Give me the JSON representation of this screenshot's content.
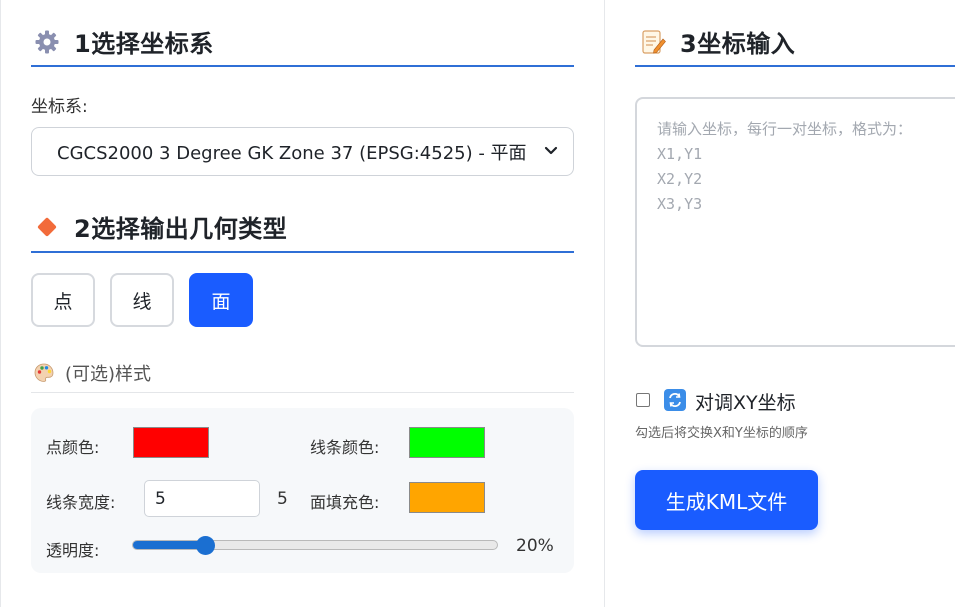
{
  "section1": {
    "title": "1选择坐标系",
    "icon": "gear-icon"
  },
  "coord_system": {
    "label": "坐标系:",
    "selected": "CGCS2000 3 Degree GK Zone 37 (EPSG:4525) - 平面"
  },
  "section2": {
    "title": "2选择输出几何类型",
    "icon": "diamond-icon"
  },
  "geometry": {
    "buttons": [
      {
        "label": "点",
        "active": false
      },
      {
        "label": "线",
        "active": false
      },
      {
        "label": "面",
        "active": true
      }
    ]
  },
  "style": {
    "title": "(可选)样式",
    "icon": "palette-icon",
    "point_color_label": "点颜色:",
    "point_color": "#ff0000",
    "line_color_label": "线条颜色:",
    "line_color": "#00ff00",
    "line_width_label": "线条宽度:",
    "line_width_value": "5",
    "line_width_display": "5",
    "fill_color_label": "面填充色:",
    "fill_color": "#ffa500",
    "opacity_label": "透明度:",
    "opacity_value": 20,
    "opacity_display": "20%"
  },
  "section3": {
    "title": "3坐标输入",
    "icon": "memo-icon"
  },
  "coord_input": {
    "placeholder": "请输入坐标，每行一对坐标，格式为：\nX1,Y1\nX2,Y2\nX3,Y3"
  },
  "swap": {
    "label": "对调XY坐标",
    "icon": "swap-icon",
    "checked": false,
    "hint": "勾选后将交换X和Y坐标的顺序"
  },
  "generate_button": "生成KML文件",
  "colors": {
    "accent": "#1a5cff",
    "section_line": "#2f6fd6"
  }
}
